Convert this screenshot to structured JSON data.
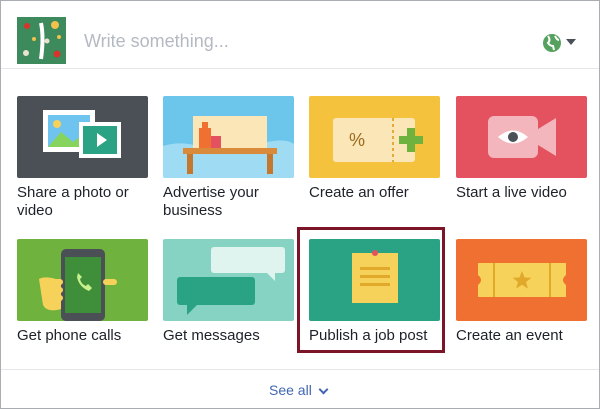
{
  "composer": {
    "placeholder": "Write something...",
    "avatar_icon": "profile-avatar-icon",
    "audience_icon": "globe-icon"
  },
  "tiles": [
    {
      "label": "Share a photo or video",
      "icon": "photo-video-icon",
      "bg": "#4b4f56"
    },
    {
      "label": "Advertise your business",
      "icon": "storefront-icon",
      "bg": "#6cc6eb"
    },
    {
      "label": "Create an offer",
      "icon": "offer-coupon-icon",
      "bg": "#f4c23d"
    },
    {
      "label": "Start a live video",
      "icon": "live-video-icon",
      "bg": "#e4515f"
    },
    {
      "label": "Get phone calls",
      "icon": "phone-call-icon",
      "bg": "#6fb23e"
    },
    {
      "label": "Get messages",
      "icon": "message-bubbles-icon",
      "bg": "#86d3c4"
    },
    {
      "label": "Publish a job post",
      "icon": "job-post-note-icon",
      "bg": "#2aa384",
      "highlighted": true
    },
    {
      "label": "Create an event",
      "icon": "event-ticket-icon",
      "bg": "#f07031"
    }
  ],
  "footer": {
    "see_all_label": "See all"
  },
  "colors": {
    "highlight_border": "#7b1527",
    "link": "#4267b2",
    "placeholder": "#b4b9c2"
  }
}
